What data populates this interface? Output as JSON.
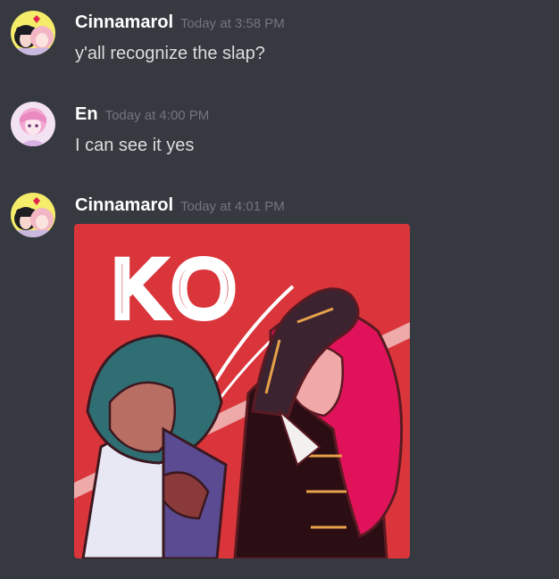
{
  "messages": [
    {
      "author": "Cinnamarol",
      "timestamp": "Today at 3:58 PM",
      "text": "y'all recognize the slap?"
    },
    {
      "author": "En",
      "timestamp": "Today at 4:00 PM",
      "text": "I can see it yes"
    },
    {
      "author": "Cinnamarol",
      "timestamp": "Today at 4:01 PM",
      "image": {
        "text": "KO"
      }
    }
  ],
  "colors": {
    "background": "#36393f",
    "username": "#ffffff",
    "timestamp": "#72767d",
    "message_text": "#dcddde",
    "image_background": "#d9353a"
  }
}
